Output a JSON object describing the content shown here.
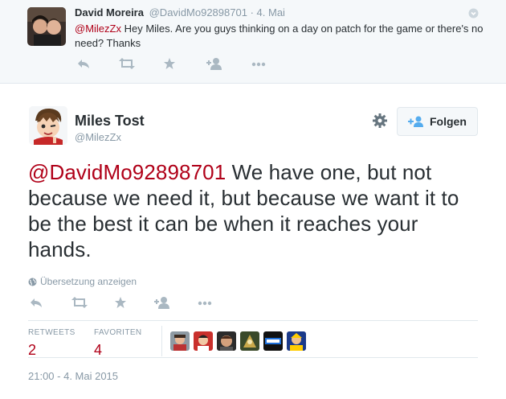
{
  "reply_tweet": {
    "author_name": "David Moreira",
    "author_handle": "@DavidMo92898701",
    "separator": "·",
    "time": "4. Mai",
    "mention": "@MilezZx",
    "text": " Hey Miles. Are you guys thinking on a day on patch for the game or there's no need? Thanks",
    "actions": [
      "reply-icon",
      "retweet-icon",
      "favorite-icon",
      "follow-icon",
      "more-icon"
    ]
  },
  "main_tweet": {
    "author_name": "Miles Tost",
    "author_handle": "@MilezZx",
    "follow_label": "Folgen",
    "mention": "@DavidMo92898701",
    "text": " We have one, but not because we need it, but because we want it to be the best it can be when it reaches your hands.",
    "translate_label": "Übersetzung anzeigen",
    "actions": [
      "reply-icon",
      "retweet-icon",
      "favorite-icon",
      "follow-icon",
      "more-icon"
    ],
    "stats": {
      "retweets_label": "RETWEETS",
      "retweets_value": "2",
      "favorites_label": "FAVORITEN",
      "favorites_value": "4"
    },
    "timestamp": "21:00 - 4. Mai 2015"
  },
  "colors": {
    "mention": "#b00018",
    "muted": "#8899a6",
    "text": "#292f33",
    "icon": "#aab8c2",
    "border": "#e1e8ed"
  }
}
